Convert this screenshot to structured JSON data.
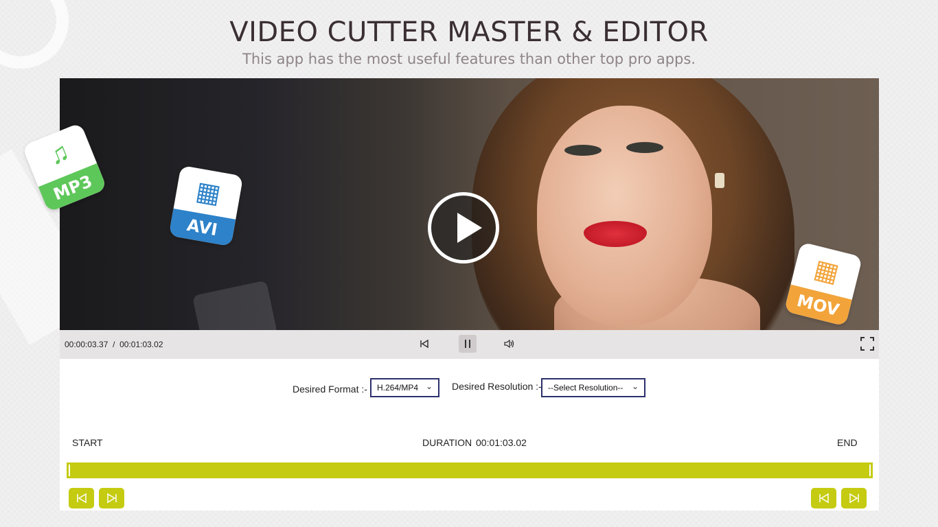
{
  "header": {
    "title": "VIDEO CUTTER MASTER & EDITOR",
    "subtitle": "This app has the most useful features than other top pro apps."
  },
  "player": {
    "current_time": "00:00:03.37",
    "separator": "/",
    "total_time": "00:01:03.02",
    "icons": {
      "play": "play-icon",
      "skip_back": "skip-back-icon",
      "pause": "pause-icon",
      "volume": "volume-icon",
      "fullscreen": "fullscreen-icon"
    }
  },
  "format": {
    "label": "Desired Format :-",
    "selected": "H.264/MP4"
  },
  "resolution": {
    "label": "Desired Resolution :-",
    "selected": "--Select Resolution--"
  },
  "timeline": {
    "start_label": "START",
    "duration_label": "DURATION",
    "duration_value": "00:01:03.02",
    "end_label": "END",
    "accent_color": "#c5cb10"
  },
  "badges": {
    "mp3": "MP3",
    "avi": "AVI",
    "mov": "MOV"
  }
}
